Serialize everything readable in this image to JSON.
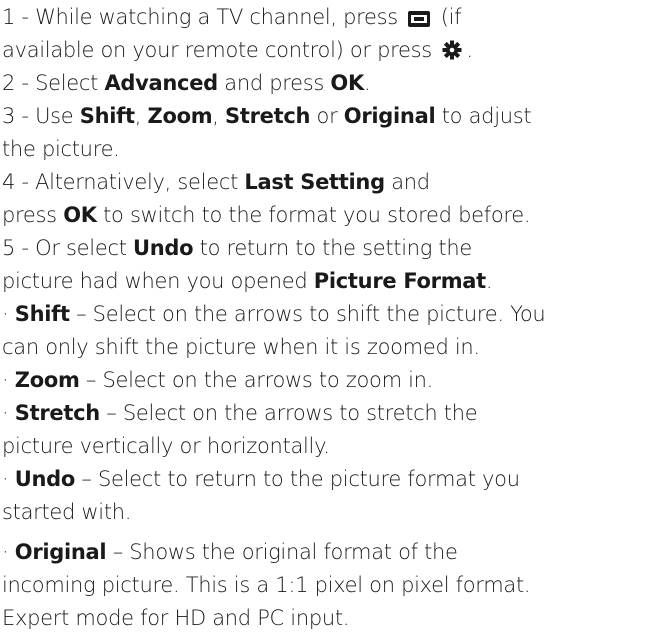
{
  "steps": {
    "s1": {
      "a": "1 -  While watching a TV channel, press ",
      "b": " (if",
      "c": "available on your remote control) or press ",
      "d": "."
    },
    "s2": {
      "a": "2 -  Select ",
      "k1": "Advanced",
      "b": " and press ",
      "k2": "OK",
      "c": "."
    },
    "s3": {
      "a": "3 -  Use ",
      "k1": "Shift",
      "sep1": ", ",
      "k2": "Zoom",
      "sep2": ", ",
      "k3": "Stretch",
      "sep3": " or ",
      "k4": "Original",
      "b": " to adjust",
      "c": "the picture."
    },
    "s4": {
      "a": "4 -  Alternatively, select ",
      "k1": "Last Setting",
      "b": " and",
      "c": "press ",
      "k2": "OK",
      "d": " to switch to the format you stored before."
    },
    "s5": {
      "a": "5 -  Or select ",
      "k1": "Undo",
      "b": " to return to the setting the",
      "c": "picture had when you opened ",
      "k2": "Picture Format",
      "d": "."
    }
  },
  "bullets": {
    "shift": {
      "dot": "· ",
      "k": "Shift",
      "a": " – Select on the arrows to shift the picture. You",
      "b": "can only shift the picture when it is zoomed in."
    },
    "zoom": {
      "dot": "· ",
      "k": "Zoom",
      "a": " – Select on the arrows to zoom in."
    },
    "stretch": {
      "dot": "· ",
      "k": "Stretch",
      "a": " – Select on the arrows to stretch the",
      "b": "picture vertically or horizontally."
    },
    "undo": {
      "dot": "· ",
      "k": "Undo",
      "a": " – Select to return to the picture format you",
      "b": "started with."
    },
    "original": {
      "dot": "· ",
      "k": "Original",
      "a": " – Shows the original format of the",
      "b": "incoming picture. This is a 1:1 pixel on pixel format.",
      "c": "Expert mode for HD and PC input."
    }
  },
  "icons": {
    "format_key": "picture-format-key-icon",
    "settings": "settings-gear-icon"
  },
  "colors": {
    "text": "#1a1a1a",
    "keyword": "#1a1a1a",
    "background": "#ffffff"
  }
}
